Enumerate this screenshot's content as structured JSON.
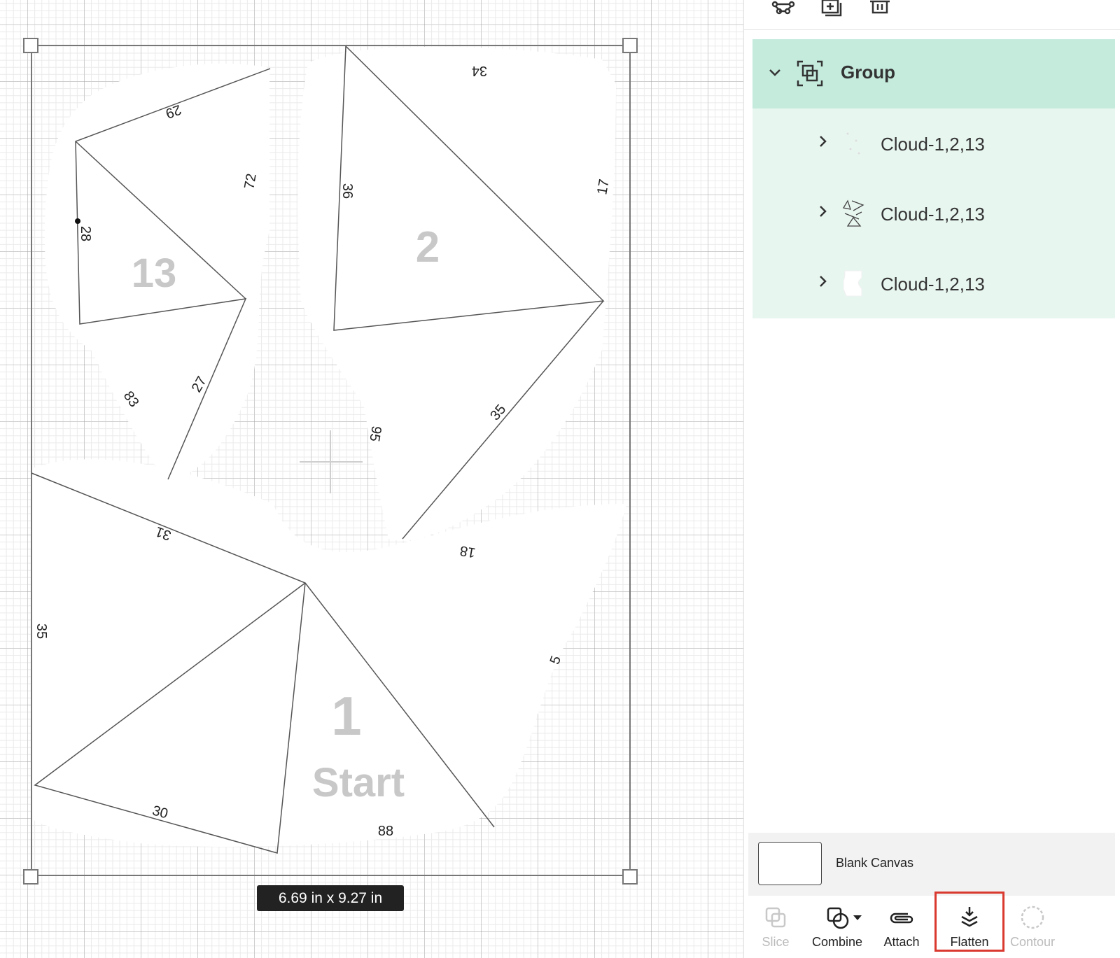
{
  "canvas": {
    "dimension_label": "6.69  in x 9.27  in",
    "piece_numbers": {
      "p13": "13",
      "p2": "2",
      "p1": "1",
      "start": "Start"
    },
    "edge_labels": {
      "e29": "29",
      "e72": "72",
      "e28": "28",
      "e83": "83",
      "e27": "27",
      "e34": "34",
      "e36": "36",
      "e17": "17",
      "e95": "95",
      "e35a": "35",
      "e18": "18",
      "e31": "31",
      "e35b": "35",
      "e5": "5",
      "e30": "30",
      "e88": "88"
    }
  },
  "layers": {
    "group": {
      "label": "Group",
      "icon": "group-icon"
    },
    "items": [
      {
        "label": "Cloud-1,2,13",
        "thumb": "blank-thumb"
      },
      {
        "label": "Cloud-1,2,13",
        "thumb": "lines-thumb"
      },
      {
        "label": "Cloud-1,2,13",
        "thumb": "shape-thumb"
      }
    ]
  },
  "blank_canvas": {
    "label": "Blank Canvas"
  },
  "toolbar": {
    "slice": "Slice",
    "combine": "Combine",
    "attach": "Attach",
    "flatten": "Flatten",
    "contour": "Contour"
  },
  "colors": {
    "group_bg": "#c5ebdd",
    "layer_bg": "#e8f6f0",
    "highlight": "#d9392f"
  }
}
